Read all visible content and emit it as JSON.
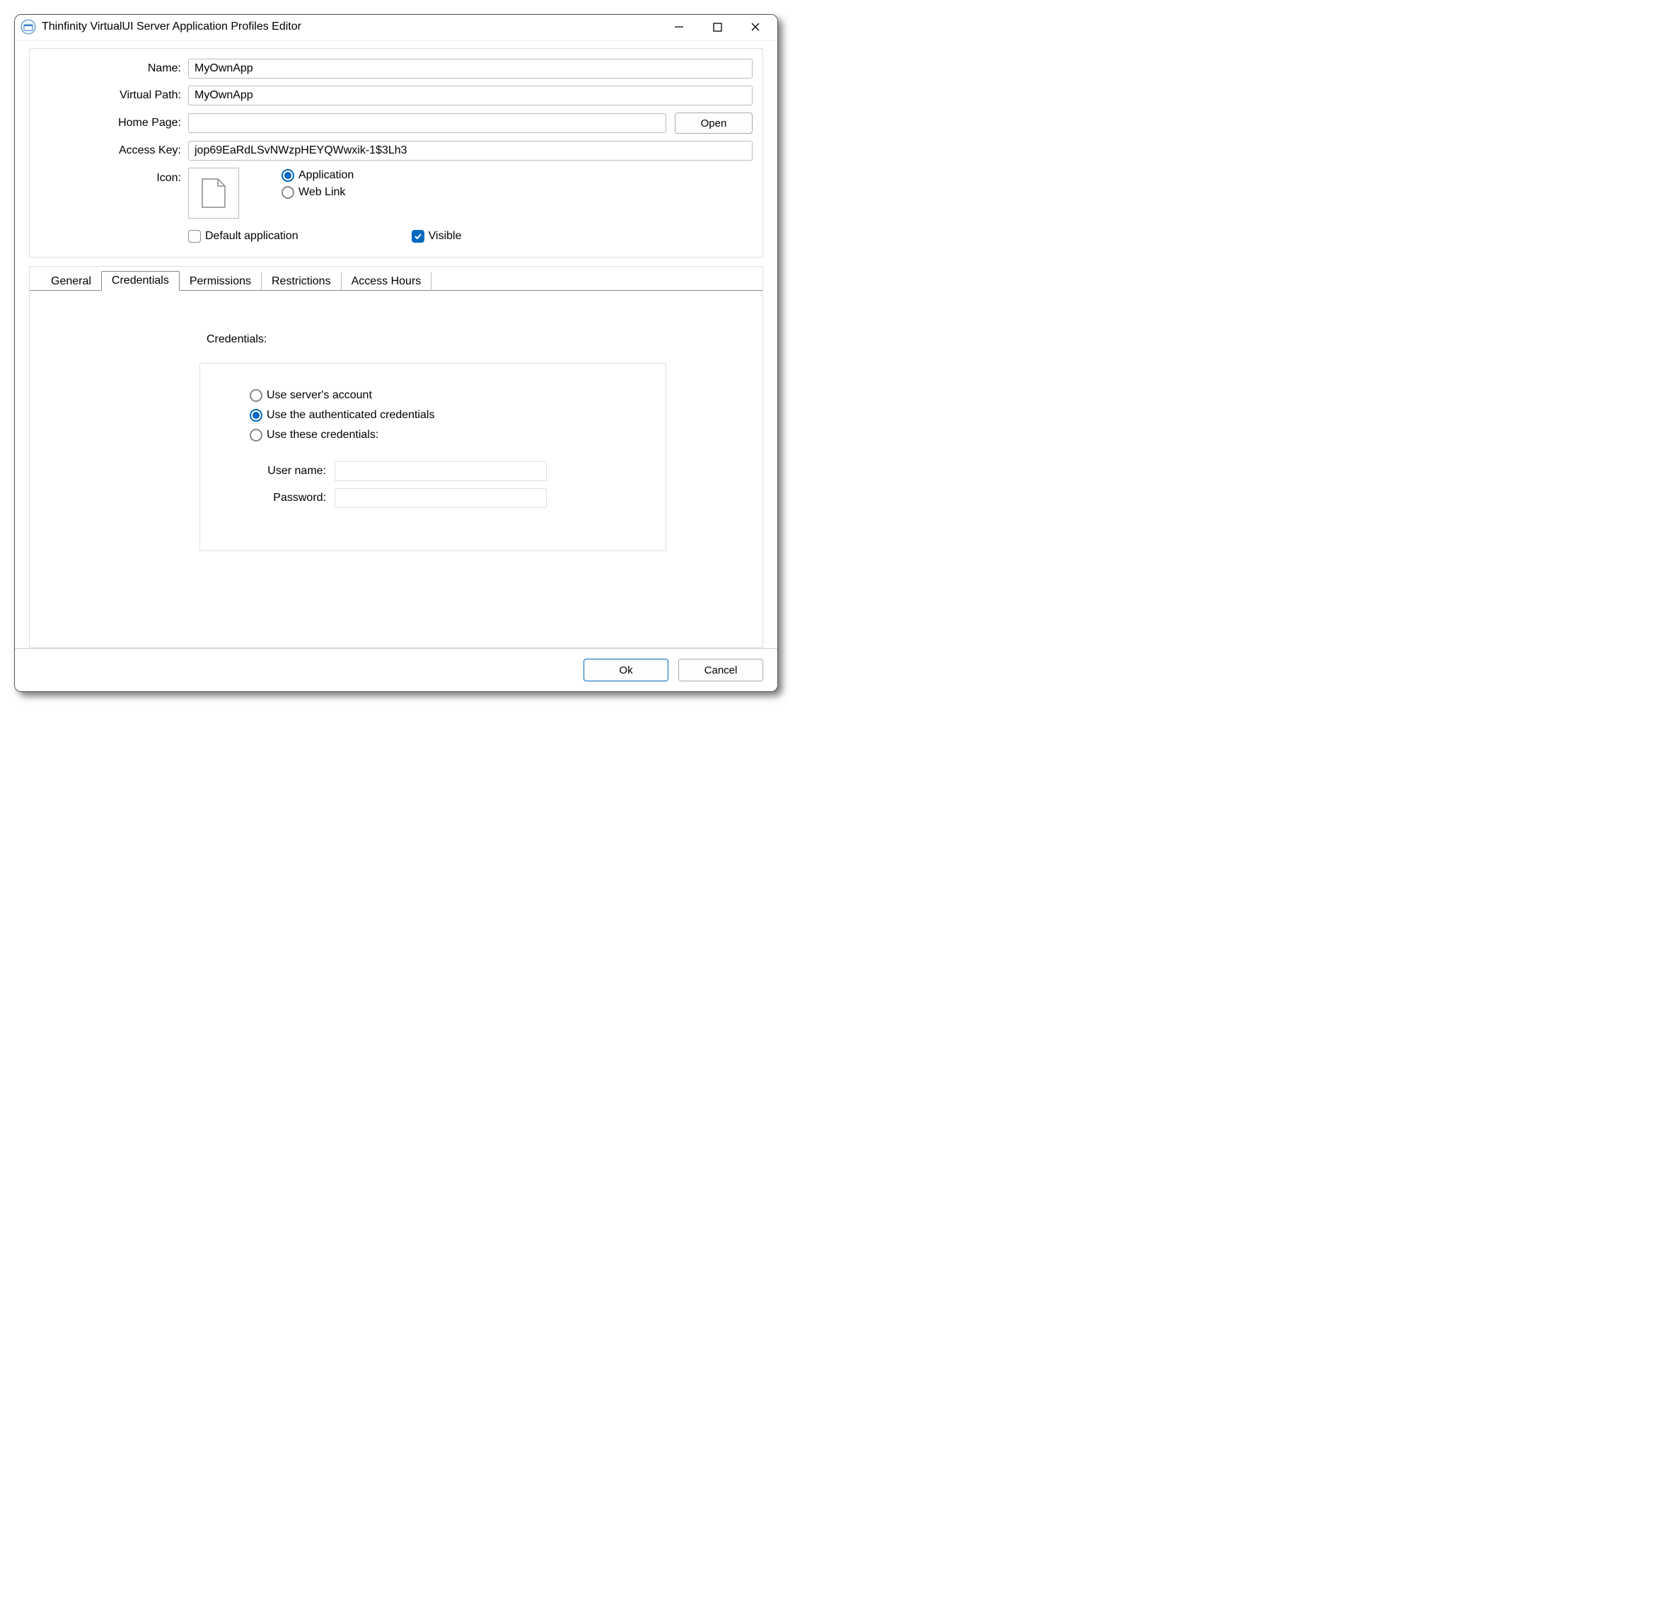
{
  "window": {
    "title": "Thinfinity VirtualUI Server Application Profiles Editor"
  },
  "form": {
    "name_label": "Name:",
    "name_value": "MyOwnApp",
    "virtual_path_label": "Virtual Path:",
    "virtual_path_value": "MyOwnApp",
    "home_page_label": "Home Page:",
    "home_page_value": "",
    "open_btn": "Open",
    "access_key_label": "Access Key:",
    "access_key_value": "jop69EaRdLSvNWzpHEYQWwxik-1$3Lh3",
    "icon_label": "Icon:",
    "radio_application": "Application",
    "radio_weblink": "Web Link",
    "chk_default_app": "Default application",
    "chk_visible": "Visible"
  },
  "tabs": {
    "general": "General",
    "credentials": "Credentials",
    "permissions": "Permissions",
    "restrictions": "Restrictions",
    "access_hours": "Access Hours"
  },
  "credentials_panel": {
    "group_label": "Credentials:",
    "opt_server": "Use server's account",
    "opt_auth": "Use the authenticated credentials",
    "opt_these": "Use these credentials:",
    "username_label": "User name:",
    "username_value": "",
    "password_label": "Password:",
    "password_value": ""
  },
  "buttons": {
    "ok": "Ok",
    "cancel": "Cancel"
  }
}
